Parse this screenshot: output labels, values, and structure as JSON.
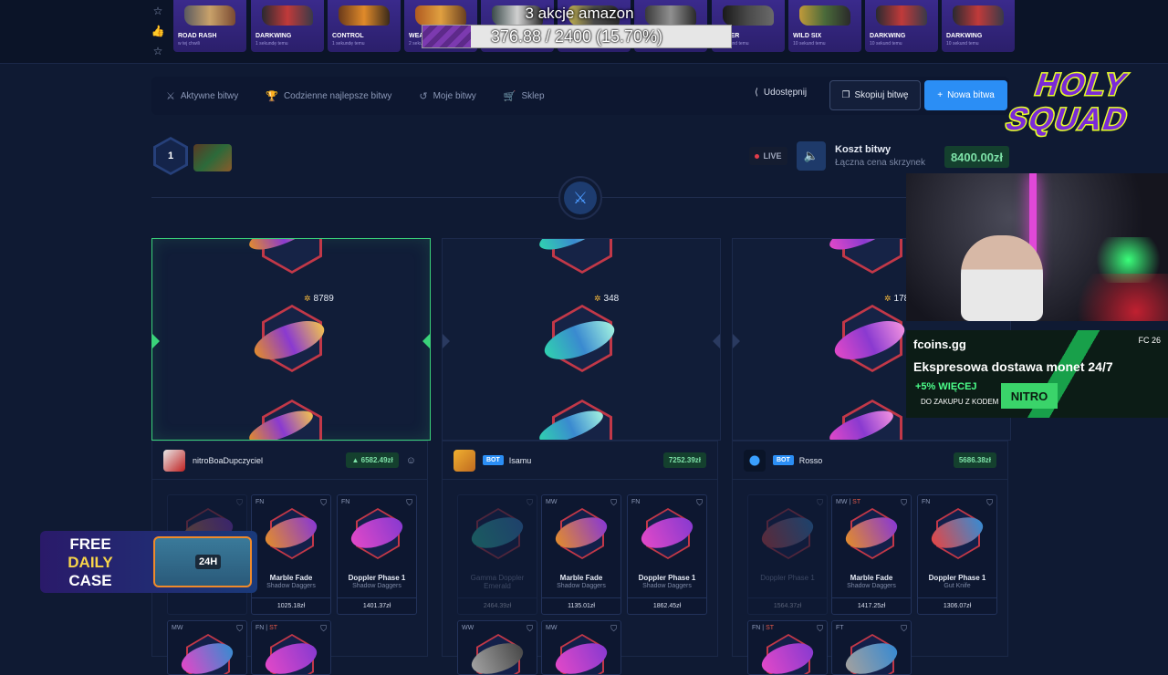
{
  "top_drops": [
    {
      "name": "ROAD RASH",
      "sub": "w tej chwili",
      "colors": [
        "#5a5a60",
        "#c9a26a",
        "#7a4a32"
      ]
    },
    {
      "name": "DARKWING",
      "sub": "1 sekundę temu",
      "colors": [
        "#2a2a30",
        "#c03a3a",
        "#3a3a48"
      ]
    },
    {
      "name": "CONTROL",
      "sub": "1 sekundę temu",
      "colors": [
        "#6a3a1a",
        "#e08a2a",
        "#3a2a1a"
      ]
    },
    {
      "name": "WEA",
      "sub": "2 sekundy temu",
      "colors": [
        "#b05a20",
        "#e0a040",
        "#6a4020"
      ]
    },
    {
      "name": "",
      "sub": "",
      "colors": [
        "#3a4a4a",
        "#d0d0d0",
        "#2a2a2a"
      ]
    },
    {
      "name": "",
      "sub": "",
      "colors": [
        "#c0b050",
        "#4a4a4a",
        "#2a2a2a"
      ]
    },
    {
      "name": "",
      "sub": "",
      "colors": [
        "#3a3a3a",
        "#909090",
        "#2a2a2a"
      ]
    },
    {
      "name": "ORCER",
      "sub": "10 sekund temu",
      "colors": [
        "#1a1a1a",
        "#4a4a4a",
        "#6a6a6a"
      ]
    },
    {
      "name": "WILD SIX",
      "sub": "10 sekund temu",
      "colors": [
        "#c09a3a",
        "#4a6a3a",
        "#2a2a2a"
      ]
    },
    {
      "name": "DARKWING",
      "sub": "10 sekund temu",
      "colors": [
        "#2a2a30",
        "#c03a3a",
        "#3a3a48"
      ]
    },
    {
      "name": "DARKWING",
      "sub": "10 sekund temu",
      "colors": [
        "#2a2a30",
        "#c03a3a",
        "#3a3a48"
      ]
    }
  ],
  "overlay": {
    "title": "3 akcje amazon",
    "progress_text": "376.88 / 2400 (15.70%)",
    "progress": 0.157
  },
  "nav": {
    "items": [
      {
        "label": "Aktywne bitwy",
        "icon": "swords-icon",
        "glyph": "⚔"
      },
      {
        "label": "Codzienne najlepsze bitwy",
        "icon": "trophy-icon",
        "glyph": "🏆"
      },
      {
        "label": "Moje bitwy",
        "icon": "history-icon",
        "glyph": "↺"
      },
      {
        "label": "Sklep",
        "icon": "basket-icon",
        "glyph": "🛒"
      }
    ],
    "share": "Udostępnij",
    "copy": "Skopiuj bitwę",
    "new": "Nowa bitwa"
  },
  "logo": {
    "line1": "HOLY",
    "line2": "SQUAD"
  },
  "battle": {
    "round": "1",
    "live": "LIVE",
    "cost_label": "Koszt bitwy",
    "cost_sub": "Łączna cena skrzynek",
    "cost_value": "8400.00zł"
  },
  "spinners": [
    {
      "value": "8789",
      "winner": true,
      "colors": [
        "#e08a30",
        "#8a3ad0",
        "#f0c050"
      ]
    },
    {
      "value": "348",
      "winner": false,
      "colors": [
        "#30d0b0",
        "#3a8ad0",
        "#a0f0e0"
      ]
    },
    {
      "value": "178",
      "winner": false,
      "colors": [
        "#e048c8",
        "#8a3ad0",
        "#f090e0"
      ]
    }
  ],
  "players": [
    {
      "name": "nitroBoaDupczyciel",
      "bot": "",
      "total": "6582.49zł",
      "cards": [
        {
          "cond": "",
          "st": "",
          "name": "",
          "type": "",
          "price": "",
          "dim": true,
          "colors": [
            "#e08a30",
            "#8a3ad0"
          ]
        },
        {
          "cond": "FN",
          "st": "",
          "name": "Marble Fade",
          "type": "Shadow Daggers",
          "price": "1025.18zł",
          "dim": false,
          "colors": [
            "#e08a30",
            "#8a3ad0"
          ]
        },
        {
          "cond": "FN",
          "st": "",
          "name": "Doppler Phase 1",
          "type": "Shadow Daggers",
          "price": "1401.37zł",
          "dim": false,
          "colors": [
            "#e048c8",
            "#8a3ad0"
          ]
        },
        {
          "cond": "MW",
          "st": "",
          "name": "",
          "type": "",
          "price": "",
          "dim": false,
          "colors": [
            "#e048c8",
            "#3a8ad0"
          ]
        },
        {
          "cond": "FN",
          "st": "ST",
          "name": "",
          "type": "",
          "price": "",
          "dim": false,
          "colors": [
            "#e048c8",
            "#8a3ad0"
          ]
        }
      ]
    },
    {
      "name": "Isamu",
      "bot": "BOT",
      "total": "7252.39zł",
      "cards": [
        {
          "cond": "",
          "st": "",
          "name": "Gamma Doppler Emerald",
          "type": "",
          "price": "2464.39zł",
          "dim": true,
          "colors": [
            "#30d0b0",
            "#3a8ad0"
          ]
        },
        {
          "cond": "MW",
          "st": "",
          "name": "Marble Fade",
          "type": "Shadow Daggers",
          "price": "1135.01zł",
          "dim": false,
          "colors": [
            "#e08a30",
            "#8a3ad0"
          ]
        },
        {
          "cond": "FN",
          "st": "",
          "name": "Doppler Phase 1",
          "type": "Shadow Daggers",
          "price": "1862.45zł",
          "dim": false,
          "colors": [
            "#e048c8",
            "#8a3ad0"
          ]
        },
        {
          "cond": "WW",
          "st": "",
          "name": "",
          "type": "",
          "price": "",
          "dim": false,
          "colors": [
            "#a0a0a0",
            "#4a4a4a"
          ]
        },
        {
          "cond": "MW",
          "st": "",
          "name": "",
          "type": "",
          "price": "",
          "dim": false,
          "colors": [
            "#e048c8",
            "#8a3ad0"
          ]
        }
      ]
    },
    {
      "name": "Rosso",
      "bot": "BOT",
      "total": "5686.38zł",
      "cards": [
        {
          "cond": "",
          "st": "",
          "name": "Doppler Phase 1",
          "type": "",
          "price": "1564.37zł",
          "dim": true,
          "colors": [
            "#e04848",
            "#3a8ad0"
          ]
        },
        {
          "cond": "MW",
          "st": "ST",
          "name": "Marble Fade",
          "type": "Shadow Daggers",
          "price": "1417.25zł",
          "dim": false,
          "colors": [
            "#e08a30",
            "#8a3ad0"
          ]
        },
        {
          "cond": "FN",
          "st": "",
          "name": "Doppler Phase 1",
          "type": "Gut Knife",
          "price": "1306.07zł",
          "dim": false,
          "colors": [
            "#e04848",
            "#3a8ad0"
          ]
        },
        {
          "cond": "FN",
          "st": "ST",
          "name": "",
          "type": "",
          "price": "",
          "dim": false,
          "colors": [
            "#e048c8",
            "#8a3ad0"
          ]
        },
        {
          "cond": "FT",
          "st": "",
          "name": "",
          "type": "",
          "price": "",
          "dim": false,
          "colors": [
            "#a0a0a0",
            "#3a8ad0"
          ]
        }
      ]
    }
  ],
  "ad": {
    "brand": "fcoins.gg",
    "platforms": "FC 26",
    "title": "Ekspresowa dostawa monet 24/7",
    "bonus": "+5% WIĘCEJ",
    "bonus_sub": "DO ZAKUPU Z KODEM",
    "code": "NITRO"
  },
  "free_daily": {
    "line1": "FREE",
    "line2": "DAILY",
    "line3": "CASE",
    "badge": "24H"
  }
}
